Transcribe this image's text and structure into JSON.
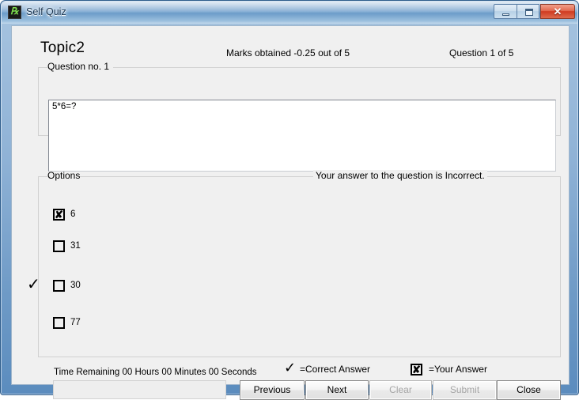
{
  "window": {
    "title": "Self Quiz",
    "icon": "app-icon",
    "controls": {
      "minimize": "minimize-icon",
      "maximize": "maximize-icon",
      "close": "✕"
    }
  },
  "header": {
    "topic": "Topic2",
    "marks": "Marks obtained -0.25 out of 5",
    "counter": "Question 1 of 5"
  },
  "question": {
    "group_legend": "Question no. 1",
    "text": "5*6=?",
    "feedback": "Your answer to the question is Incorrect."
  },
  "options": {
    "group_legend": "Options",
    "items": [
      {
        "label": "6",
        "state": "your-answer",
        "mark": "✘"
      },
      {
        "label": "31",
        "state": "unchecked",
        "mark": ""
      },
      {
        "label": "30",
        "state": "unchecked",
        "mark": ""
      },
      {
        "label": "77",
        "state": "unchecked",
        "mark": ""
      }
    ],
    "correct_marker": "✓"
  },
  "footer": {
    "time_label": "Time Remaining  00 Hours 00 Minutes 00 Seconds",
    "time_progress_value": "",
    "legend": {
      "correct_tick": "✓",
      "correct_text": "=Correct Answer",
      "your_mark": "✘",
      "your_text": "=Your Answer"
    },
    "buttons": [
      {
        "label": "Previous",
        "enabled": true
      },
      {
        "label": "Next",
        "enabled": true
      },
      {
        "label": "Clear",
        "enabled": false
      },
      {
        "label": "Submit",
        "enabled": false
      },
      {
        "label": "Close",
        "enabled": true
      }
    ]
  },
  "colors": {
    "titlebar_blue": "#7ba7d0",
    "close_red": "#cf3a20",
    "client_bg": "#f0f0f0",
    "field_bg": "#ffffff"
  }
}
